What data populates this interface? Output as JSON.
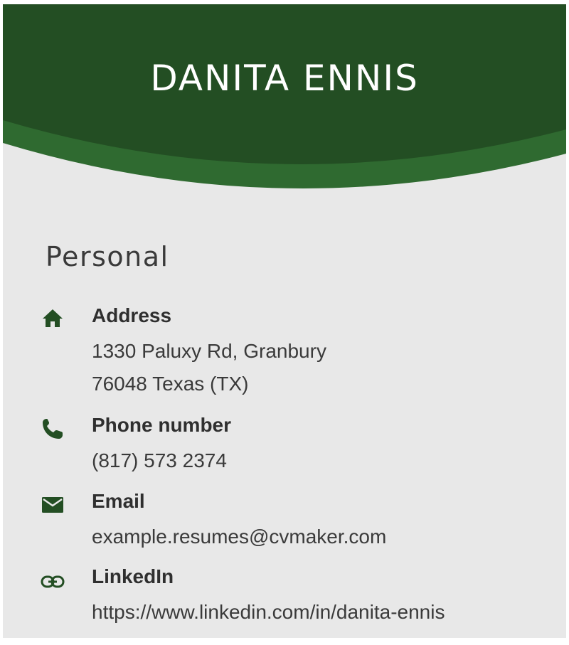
{
  "header": {
    "name": "DANITA ENNIS"
  },
  "colors": {
    "header_dark": "#234e23",
    "header_accent": "#2f6a30",
    "icon": "#234e23",
    "card_bg": "#e8e8e8"
  },
  "personal": {
    "title": "Personal",
    "items": [
      {
        "icon": "home-icon",
        "label": "Address",
        "lines": [
          "1330 Paluxy Rd, Granbury",
          "76048 Texas (TX)"
        ]
      },
      {
        "icon": "phone-icon",
        "label": "Phone number",
        "lines": [
          "(817) 573 2374"
        ]
      },
      {
        "icon": "email-icon",
        "label": "Email",
        "lines": [
          "example.resumes@cvmaker.com"
        ]
      },
      {
        "icon": "link-icon",
        "label": "LinkedIn",
        "lines": [
          "https://www.linkedin.com/in/danita-ennis"
        ]
      }
    ]
  }
}
